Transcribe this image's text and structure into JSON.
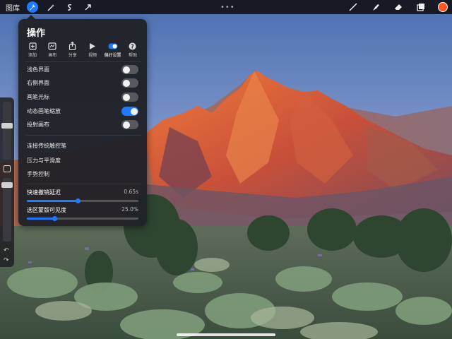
{
  "topbar": {
    "gallery": "图库",
    "dots": "•••",
    "icons": [
      "wrench-icon",
      "magic-wand-icon",
      "selection-icon",
      "transform-arrow-icon",
      "brush-icon",
      "smudge-icon",
      "eraser-icon",
      "layers-icon"
    ],
    "color": "#ff5722"
  },
  "panel": {
    "title": "操作",
    "tabs": [
      {
        "label": "添加",
        "icon": "add-icon"
      },
      {
        "label": "画布",
        "icon": "canvas-icon"
      },
      {
        "label": "分享",
        "icon": "share-icon"
      },
      {
        "label": "视频",
        "icon": "video-play-icon"
      },
      {
        "label": "偏好设置",
        "icon": "preferences-toggle-icon",
        "active": true
      },
      {
        "label": "帮助",
        "icon": "help-icon"
      }
    ],
    "toggles": [
      {
        "label": "浅色界面",
        "on": false
      },
      {
        "label": "右侧界面",
        "on": false
      },
      {
        "label": "画笔光标",
        "on": false
      },
      {
        "label": "动态画笔缩放",
        "on": true
      },
      {
        "label": "投射画布",
        "on": false
      }
    ],
    "links": [
      "连接传统触控笔",
      "压力与平滑度",
      "手势控制"
    ],
    "sliders": [
      {
        "label": "快速撤销延迟",
        "value": "0.65s",
        "fraction": 0.46
      },
      {
        "label": "选区蒙版可见度",
        "value": "25.0%",
        "fraction": 0.25
      }
    ]
  },
  "colors": {
    "accent": "#1e7bff",
    "panel": "#202126",
    "current_color": "#ff5722"
  }
}
